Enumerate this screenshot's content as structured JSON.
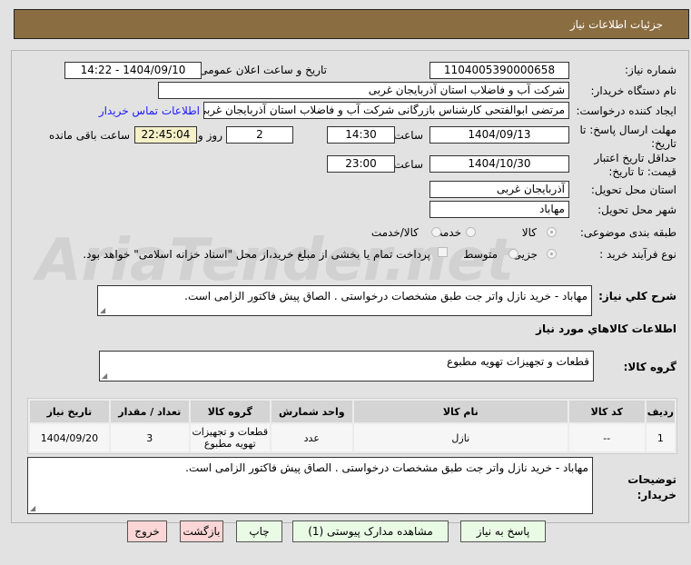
{
  "header": {
    "title": "جزئیات اطلاعات نیاز"
  },
  "watermark": "AriaTender.net",
  "form": {
    "need_number_label": "شماره نیاز:",
    "need_number": "1104005390000658",
    "announce_label": "تاریخ و ساعت اعلان عمومی:",
    "announce_value": "1404/09/10 - 14:22",
    "buyer_label": "نام دستگاه خریدار:",
    "buyer": "شرکت آب و فاضلاب استان آذربایجان غربی",
    "creator_label": "ایجاد کننده درخواست:",
    "creator": "مرتضی ابوالفتحی کارشناس بازرگانی شرکت آب و فاضلاب استان آذربایجان غربی",
    "contact_link": "اطلاعات تماس خریدار",
    "deadline_label": "مهلت ارسال پاسخ: تا تاریخ:",
    "deadline_date": "1404/09/13",
    "time_label": "ساعت",
    "deadline_time": "14:30",
    "days": "2",
    "days_label": "روز و",
    "remaining": "22:45:04",
    "remaining_label": "ساعت باقی مانده",
    "validity_label": "حداقل تاریخ اعتبار قیمت: تا تاریخ:",
    "validity_date": "1404/10/30",
    "validity_time": "23:00",
    "province_label": "استان محل تحویل:",
    "province": "آذربایجان غربی",
    "city_label": "شهر محل تحویل:",
    "city": "مهاباد",
    "category_label": "طبقه بندی موضوعی:",
    "category_options": [
      "کالا",
      "خدمت",
      "کالا/خدمت"
    ],
    "category_selected": "کالا",
    "process_label": "نوع فرآیند خرید :",
    "process_options": [
      "جزیی",
      "متوسط"
    ],
    "process_selected": "جزیی",
    "payment_note": "پرداخت تمام یا بخشی از مبلغ خرید،از محل \"اسناد خزانه اسلامی\" خواهد بود.",
    "description_label": "شرح كلي نياز:",
    "description": "مهاباد - خرید نازل واتر جت  طبق مشخصات درخواستی . الصاق پیش فاکتور الزامی است.",
    "goods_info_title": "اطلاعات كالاهاي مورد نياز",
    "goods_group_label": "گروه کالا:",
    "goods_group": "قطعات و تجهیزات تهویه مطبوع"
  },
  "table": {
    "headers": [
      "ردیف",
      "کد کالا",
      "نام کالا",
      "واحد شمارش",
      "گروه کالا",
      "تعداد / مقدار",
      "تاریخ نیاز"
    ],
    "rows": [
      [
        "1",
        "--",
        "نازل",
        "عدد",
        "قطعات و تجهیزات تهویه مطبوع",
        "3",
        "1404/09/20"
      ]
    ]
  },
  "buyer_notes": {
    "label": "توضیحات خریدار:",
    "text": "مهاباد - خرید نازل واتر جت  طبق مشخصات درخواستی . الصاق پیش فاکتور الزامی است."
  },
  "buttons": {
    "reply": "پاسخ به نیاز",
    "attachments": "مشاهده مدارک پیوستی (1)",
    "print": "چاپ",
    "back": "بازگشت",
    "exit": "خروج"
  }
}
